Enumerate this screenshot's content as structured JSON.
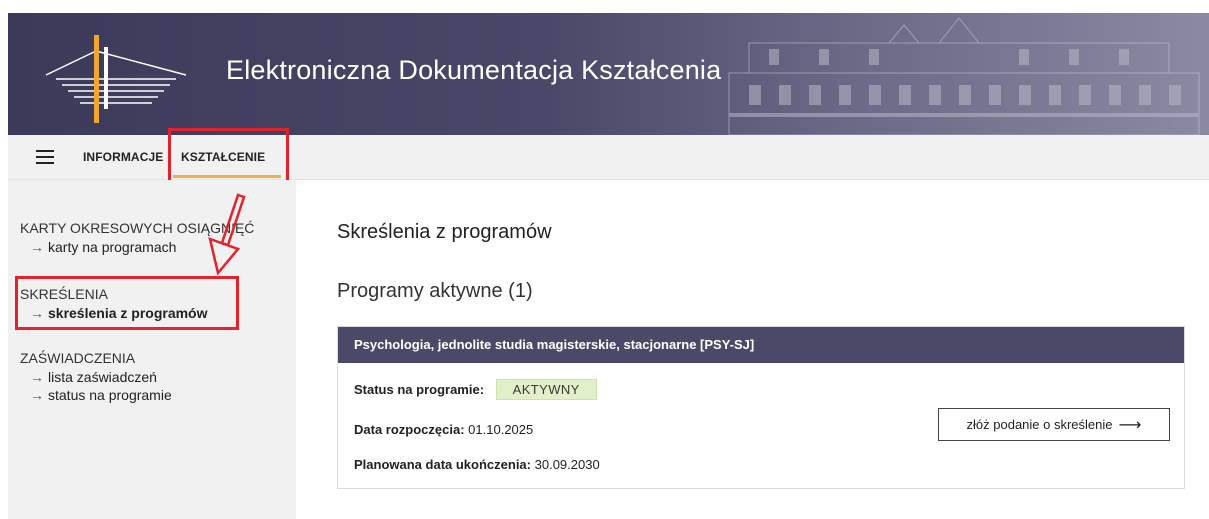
{
  "header": {
    "app_title": "Elektroniczna Dokumentacja Kształcenia"
  },
  "nav": {
    "items": [
      {
        "label": "INFORMACJE"
      },
      {
        "label": "KSZTAŁCENIE"
      }
    ]
  },
  "sidebar": {
    "groups": [
      {
        "heading": "KARTY OKRESOWYCH OSIĄGNIĘĆ",
        "links": [
          {
            "arrow": "→",
            "label": "karty na programach"
          }
        ]
      },
      {
        "heading": "SKREŚLENIA",
        "links": [
          {
            "arrow": "→",
            "label": "skreślenia z programów"
          }
        ]
      },
      {
        "heading": "ZAŚWIADCZENIA",
        "links": [
          {
            "arrow": "→",
            "label": "lista zaświadczeń"
          },
          {
            "arrow": "→",
            "label": "status na programie"
          }
        ]
      }
    ]
  },
  "main": {
    "title": "Skreślenia z programów",
    "section_title": "Programy aktywne (1)",
    "program": {
      "name": "Psychologia, jednolite studia magisterskie, stacjonarne [PSY-SJ]",
      "status_label": "Status na programie:",
      "status_value": "AKTYWNY",
      "start_label": "Data rozpoczęcia:",
      "start_value": "01.10.2025",
      "end_label": "Planowana data ukończenia:",
      "end_value": "30.09.2030",
      "action_label": "złóż podanie o skreślenie",
      "action_arrow": "⟶"
    }
  },
  "colors": {
    "header_bg": "#3c3a59",
    "card_head_bg": "#4a4a68",
    "accent_underline": "#f2b04a",
    "highlight_red": "#e0232c",
    "badge_bg": "#e1f0c8",
    "link_arrow": "#c2272d"
  },
  "icons": {
    "menu": "hamburger-icon",
    "logo": "university-logo",
    "arrow": "right-arrow-icon"
  }
}
